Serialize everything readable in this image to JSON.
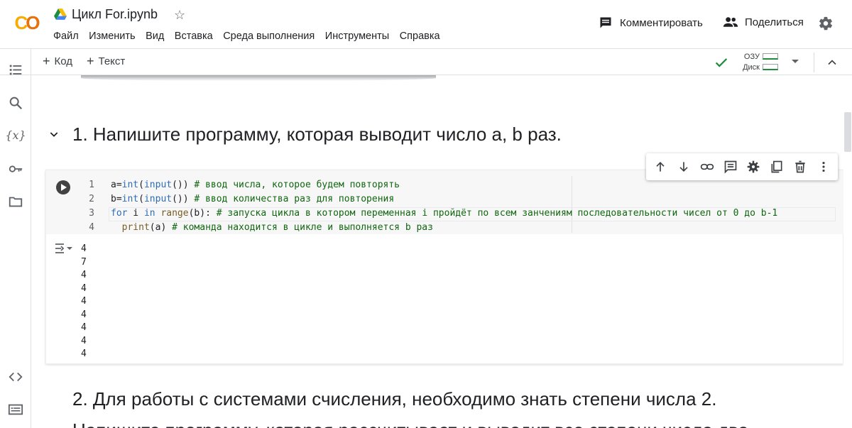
{
  "header": {
    "notebook_title": "Цикл For.ipynb",
    "menu": [
      "Файл",
      "Изменить",
      "Вид",
      "Вставка",
      "Среда выполнения",
      "Инструменты",
      "Справка"
    ],
    "comment_label": "Комментировать",
    "share_label": "Поделиться"
  },
  "toolbar": {
    "add_code": "Код",
    "add_text": "Текст",
    "ram_label": "ОЗУ",
    "disk_label": "Диск"
  },
  "rail": {
    "icons": [
      "toc-icon",
      "search-icon",
      "variables-icon",
      "key-icon",
      "folder-icon",
      "code-snippets-icon",
      "terminal-icon"
    ],
    "variables_glyph": "{x}"
  },
  "notebook": {
    "heading1": "1. Напишите программу, которая выводит число а, b раз.",
    "cell": {
      "line_numbers": [
        "1",
        "2",
        "3",
        "4"
      ],
      "lines": [
        [
          {
            "t": "a",
            "c": "vr"
          },
          {
            "t": "=",
            "c": "vr"
          },
          {
            "t": "int",
            "c": "bi"
          },
          {
            "t": "(",
            "c": "vr"
          },
          {
            "t": "input",
            "c": "bi"
          },
          {
            "t": "()) ",
            "c": "vr"
          },
          {
            "t": "# ввод числа, которое будем повторять",
            "c": "cm"
          }
        ],
        [
          {
            "t": "b",
            "c": "vr"
          },
          {
            "t": "=",
            "c": "vr"
          },
          {
            "t": "int",
            "c": "bi"
          },
          {
            "t": "(",
            "c": "vr"
          },
          {
            "t": "input",
            "c": "bi"
          },
          {
            "t": "()) ",
            "c": "vr"
          },
          {
            "t": "# ввод количества раз для повторения",
            "c": "cm"
          }
        ],
        [
          {
            "t": "for",
            "c": "kw"
          },
          {
            "t": " i ",
            "c": "vr"
          },
          {
            "t": "in",
            "c": "kw"
          },
          {
            "t": " ",
            "c": "vr"
          },
          {
            "t": "range",
            "c": "fn"
          },
          {
            "t": "(b): ",
            "c": "vr"
          },
          {
            "t": "# запуска цикла в котором переменная i пройдёт по всем занчениям последовательности чисел от 0 до b-1",
            "c": "cm"
          }
        ],
        [
          {
            "t": "  ",
            "c": "vr"
          },
          {
            "t": "print",
            "c": "fn"
          },
          {
            "t": "(a) ",
            "c": "vr"
          },
          {
            "t": "# команда находится в цикле и выполняется b раз",
            "c": "cm"
          }
        ]
      ],
      "output": [
        "4",
        "7",
        "4",
        "4",
        "4",
        "4",
        "4",
        "4",
        "4"
      ]
    },
    "heading2": "2. Для работы с системами счисления, необходимо знать степени числа 2.",
    "paragraph_cut": "Напишите программу, которая рассчитывает и выводит все степени числа два"
  },
  "colors": {
    "accent_green": "#1e8e3e",
    "logo_yellow": "#f9ab00",
    "logo_orange": "#e8710a",
    "keyword_blue": "#2f6db6",
    "comment_green": "#116611"
  }
}
